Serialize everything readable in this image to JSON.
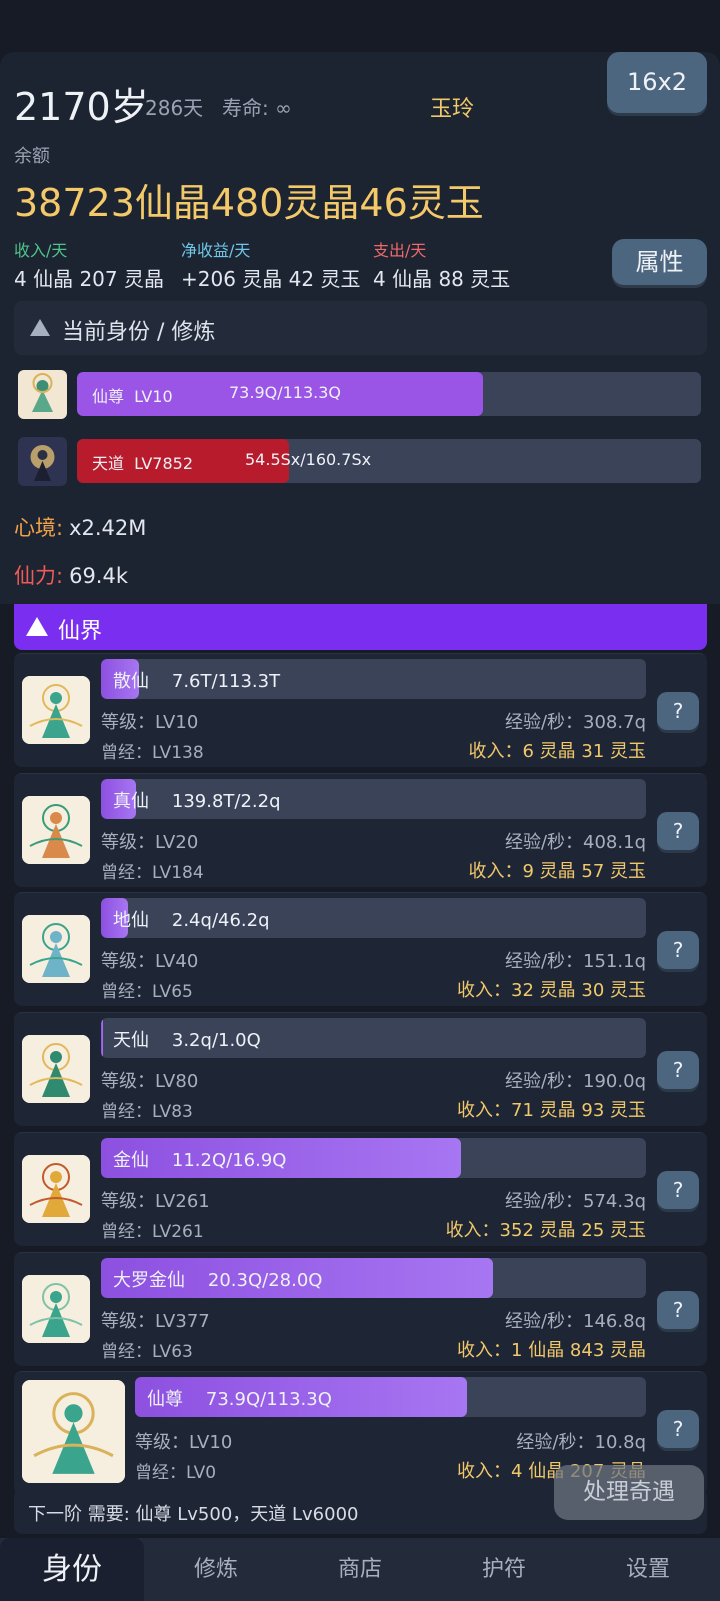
{
  "header": {
    "age": "2170岁",
    "days": "286天",
    "lifespan_label": "寿命:",
    "lifespan_value": "∞",
    "player_name": "玉玲",
    "speed_button": "16x2",
    "balance_label": "余额",
    "balance_value": "38723仙晶480灵晶46灵玉",
    "income_label": "收入/天",
    "income_value": "4 仙晶 207 灵晶",
    "net_label": "净收益/天",
    "net_value": "+206 灵晶 42 灵玉",
    "expense_label": "支出/天",
    "expense_value": "4 仙晶 88 灵玉",
    "attributes_button": "属性",
    "colors": {
      "income": "#4fc48a",
      "net": "#6fc6e6",
      "expense": "#ef6a6a",
      "gold": "#f3c96a"
    }
  },
  "identity": {
    "section_title": "当前身份 / 修炼",
    "rows": [
      {
        "label": "仙尊  LV10",
        "progress": "73.9Q/113.3Q",
        "fraction": 0.65,
        "color": "#9a55e6"
      },
      {
        "label": "天道  LV7852",
        "progress": "54.5Sx/160.7Sx",
        "fraction": 0.34,
        "color": "#b81c2c"
      }
    ],
    "mind_label": "心境:",
    "mind_value": "x2.42M",
    "power_label": "仙力:",
    "power_value": "69.4k"
  },
  "realm": {
    "title": "仙界",
    "cards": [
      {
        "name": "散仙",
        "progress": "7.6T/113.3T",
        "fraction": 0.07,
        "level": "等级：LV10",
        "once": "曾经：LV138",
        "exp": "经验/秒：308.7q",
        "income": "收入：6 灵晶 31 灵玉",
        "help": "?"
      },
      {
        "name": "真仙",
        "progress": "139.8T/2.2q",
        "fraction": 0.065,
        "level": "等级：LV20",
        "once": "曾经：LV184",
        "exp": "经验/秒：408.1q",
        "income": "收入：9 灵晶 57 灵玉",
        "help": "?"
      },
      {
        "name": "地仙",
        "progress": "2.4q/46.2q",
        "fraction": 0.05,
        "level": "等级：LV40",
        "once": "曾经：LV65",
        "exp": "经验/秒：151.1q",
        "income": "收入：32 灵晶 30 灵玉",
        "help": "?"
      },
      {
        "name": "天仙",
        "progress": "3.2q/1.0Q",
        "fraction": 0.004,
        "level": "等级：LV80",
        "once": "曾经：LV83",
        "exp": "经验/秒：190.0q",
        "income": "收入：71 灵晶 93 灵玉",
        "help": "?"
      },
      {
        "name": "金仙",
        "progress": "11.2Q/16.9Q",
        "fraction": 0.66,
        "level": "等级：LV261",
        "once": "曾经：LV261",
        "exp": "经验/秒：574.3q",
        "income": "收入：352 灵晶 25 灵玉",
        "help": "?"
      },
      {
        "name": "大罗金仙",
        "progress": "20.3Q/28.0Q",
        "fraction": 0.72,
        "level": "等级：LV377",
        "once": "曾经：LV63",
        "exp": "经验/秒：146.8q",
        "income": "收入：1 仙晶 843 灵晶",
        "help": "?"
      },
      {
        "name": "仙尊",
        "progress": "73.9Q/113.3Q",
        "fraction": 0.65,
        "level": "等级：LV10",
        "once": "曾经：LV0",
        "exp": "经验/秒：10.8q",
        "income": "收入：4 仙晶 207 灵晶",
        "help": "?"
      }
    ]
  },
  "footer": {
    "next_requirement": "下一阶 需要: 仙尊 Lv500，天道 Lv6000",
    "event_button": "处理奇遇"
  },
  "tabs": [
    {
      "label": "身份",
      "active": true
    },
    {
      "label": "修炼",
      "active": false
    },
    {
      "label": "商店",
      "active": false
    },
    {
      "label": "护符",
      "active": false
    },
    {
      "label": "设置",
      "active": false
    }
  ]
}
